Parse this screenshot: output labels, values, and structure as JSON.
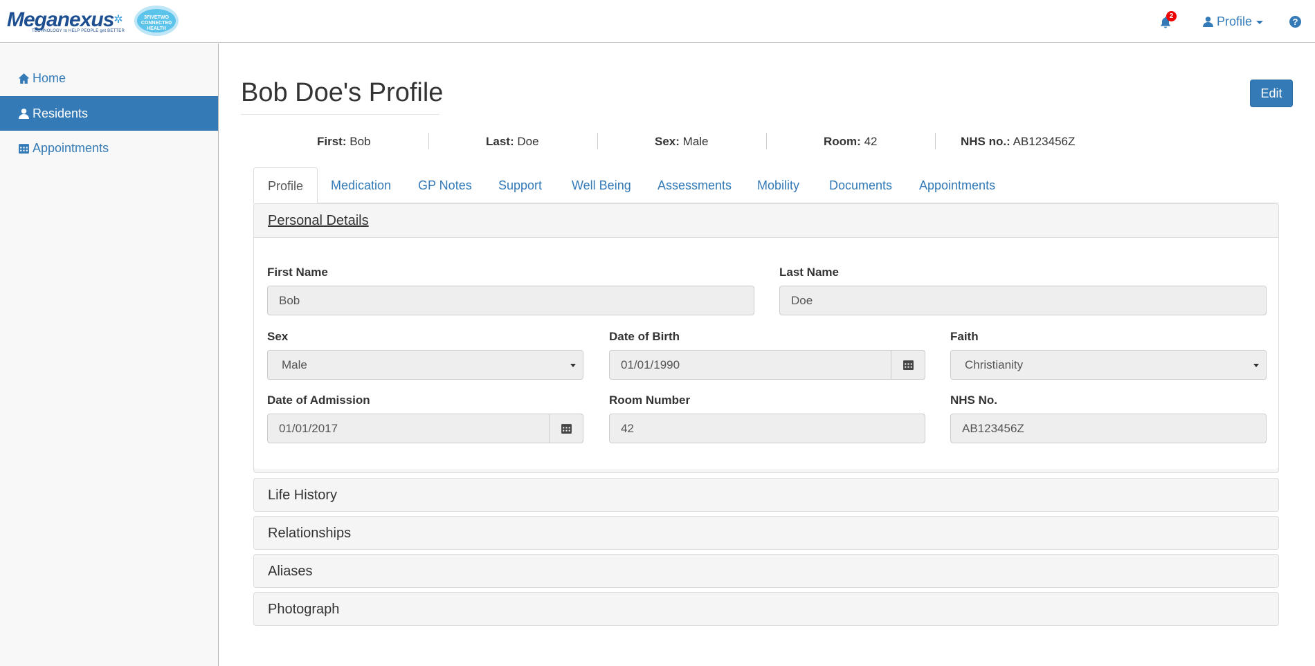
{
  "header": {
    "logo_text": "Meganexus",
    "logo_tagline": "TECHNOLOGY to HELP PEOPLE get BETTER",
    "partner_logo_text": "3FIVETWO CONNECTED HEALTH",
    "notification_count": "2",
    "profile_label": "Profile",
    "help_label": "?"
  },
  "sidebar": {
    "items": [
      {
        "label": "Home",
        "icon": "home-icon",
        "active": false
      },
      {
        "label": "Residents",
        "icon": "user-icon",
        "active": true
      },
      {
        "label": "Appointments",
        "icon": "calendar-icon",
        "active": false
      }
    ]
  },
  "page": {
    "title": "Bob Doe's Profile",
    "edit_label": "Edit"
  },
  "summary": {
    "first_label": "First:",
    "first_value": "Bob",
    "last_label": "Last:",
    "last_value": "Doe",
    "sex_label": "Sex:",
    "sex_value": "Male",
    "room_label": "Room:",
    "room_value": "42",
    "nhs_label": "NHS no.:",
    "nhs_value": "AB123456Z"
  },
  "tabs": [
    "Profile",
    "Medication",
    "GP Notes",
    "Support",
    "Well Being",
    "Assessments",
    "Mobility",
    "Documents",
    "Appointments"
  ],
  "active_tab": "Profile",
  "personal_details": {
    "heading": "Personal Details",
    "first_name": {
      "label": "First Name",
      "value": "Bob"
    },
    "last_name": {
      "label": "Last Name",
      "value": "Doe"
    },
    "sex": {
      "label": "Sex",
      "value": "Male"
    },
    "dob": {
      "label": "Date of Birth",
      "value": "01/01/1990"
    },
    "faith": {
      "label": "Faith",
      "value": "Christianity"
    },
    "admission": {
      "label": "Date of Admission",
      "value": "01/01/2017"
    },
    "room": {
      "label": "Room Number",
      "value": "42"
    },
    "nhs": {
      "label": "NHS No.",
      "value": "AB123456Z"
    }
  },
  "sections": [
    "Life History",
    "Relationships",
    "Aliases",
    "Photograph"
  ],
  "colors": {
    "primary": "#337ab7",
    "badge": "#ee0000",
    "panel_bg": "#f5f5f5",
    "input_bg": "#eeeeee"
  }
}
